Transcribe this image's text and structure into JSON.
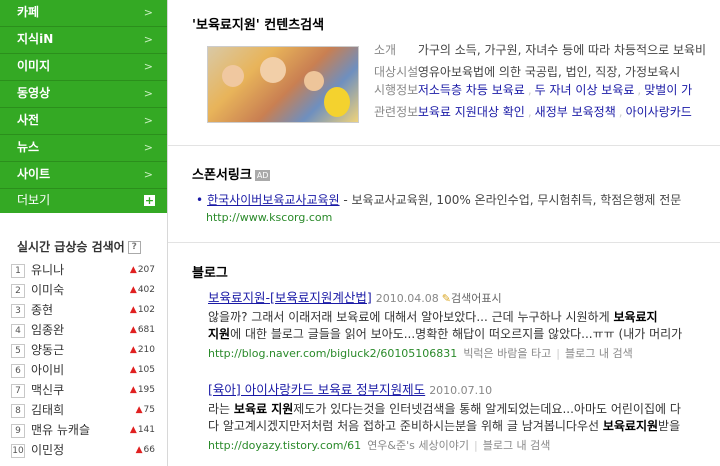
{
  "sidebar": {
    "nav": [
      "카페",
      "지식iN",
      "이미지",
      "동영상",
      "사전",
      "뉴스",
      "사이트"
    ],
    "arrow": ">",
    "more_label": "더보기",
    "more_icon": "+",
    "realtime_title": "실시간 급상승 검색어",
    "realtime_help": "?",
    "realtime": [
      {
        "rank": "1",
        "word": "유니나",
        "change": "207"
      },
      {
        "rank": "2",
        "word": "이미숙",
        "change": "402"
      },
      {
        "rank": "3",
        "word": "종현",
        "change": "102"
      },
      {
        "rank": "4",
        "word": "임종완",
        "change": "681"
      },
      {
        "rank": "5",
        "word": "양동근",
        "change": "210"
      },
      {
        "rank": "6",
        "word": "아이비",
        "change": "105"
      },
      {
        "rank": "7",
        "word": "맥신쿠",
        "change": "195"
      },
      {
        "rank": "8",
        "word": "김태희",
        "change": "75"
      },
      {
        "rank": "9",
        "word": "맨유 뉴캐슬",
        "change": "141"
      },
      {
        "rank": "10",
        "word": "이민정",
        "change": "66"
      }
    ]
  },
  "content": {
    "title": "'보육료지원' 컨텐츠검색",
    "intro_label": "소개",
    "intro_text": "가구의 소득, 가구원, 자녀수 등에 따라 차등적으로 보육비",
    "target_label": "대상시설",
    "target_text": "영유아보육법에 의한 국공립, 법인, 직장, 가정보육시",
    "info_label": "시행정보",
    "info_links": [
      "저소득층 차등 보육료",
      "두 자녀 이상 보육료",
      "맞벌이 가"
    ],
    "related_label": "관련정보",
    "related_links": [
      "보육료 지원대상 확인",
      "새정부 보육정책",
      "아이사랑카드"
    ]
  },
  "sponsor": {
    "title": "스폰서링크",
    "badge": "AD",
    "link": "한국사이버보육교사교육원",
    "desc": " - 보육교사교육원, 100% 온라인수업, 무시험취득, 학점은행제 전문",
    "url": "http://www.kscorg.com"
  },
  "blog": {
    "title": "블로그",
    "items": [
      {
        "title": "보육료지원-[보육료지원계산법]",
        "date": "2010.04.08",
        "source": "검색어표시",
        "line1_pre": "않을까? 그래서 이래저래 보육료에 대해서 알아보았다... 근데 누구하나 시원하게 ",
        "line1_bold": "보육료지",
        "line2_bold": "지원",
        "line2_post": "에 대한 블로그 글들을 읽어 보아도...명확한 해답이 떠오르지를 않았다...ㅠㅠ (내가 머리가",
        "url": "http://blog.naver.com/bigluck2/60105106831",
        "author": "빅럭은 바람을 타고",
        "inblog": "블로그 내 검색"
      },
      {
        "title": "[육아] 아이사랑카드 보육료 정부지원제도",
        "date": "2010.07.10",
        "line1_pre": "라는 ",
        "line1_bold": "보육료 지원",
        "line1_post": "제도가 있다는것을 인터넷검색을 통해 알게되었는데요...아마도 어린이집에 다",
        "line2_pre": "다 알고계시겠지만저처럼 처음 접하고 준비하시는분을 위해 글 남겨봅니다우선 ",
        "line2_bold": "보육료지원",
        "line2_post": "받을",
        "url": "http://doyazy.tistory.com/61",
        "author": "연우&준's 세상이야기",
        "inblog": "블로그 내 검색"
      }
    ]
  },
  "colors": {
    "nav_green": "#34a924",
    "link": "#1a1aa6",
    "url_green": "#2a8a2a",
    "up_red": "#e02020"
  },
  "icons": {
    "thumbnail": "daycare-photo",
    "pencil": "pencil-icon",
    "up": "up-arrow-icon",
    "plus": "plus-icon"
  }
}
